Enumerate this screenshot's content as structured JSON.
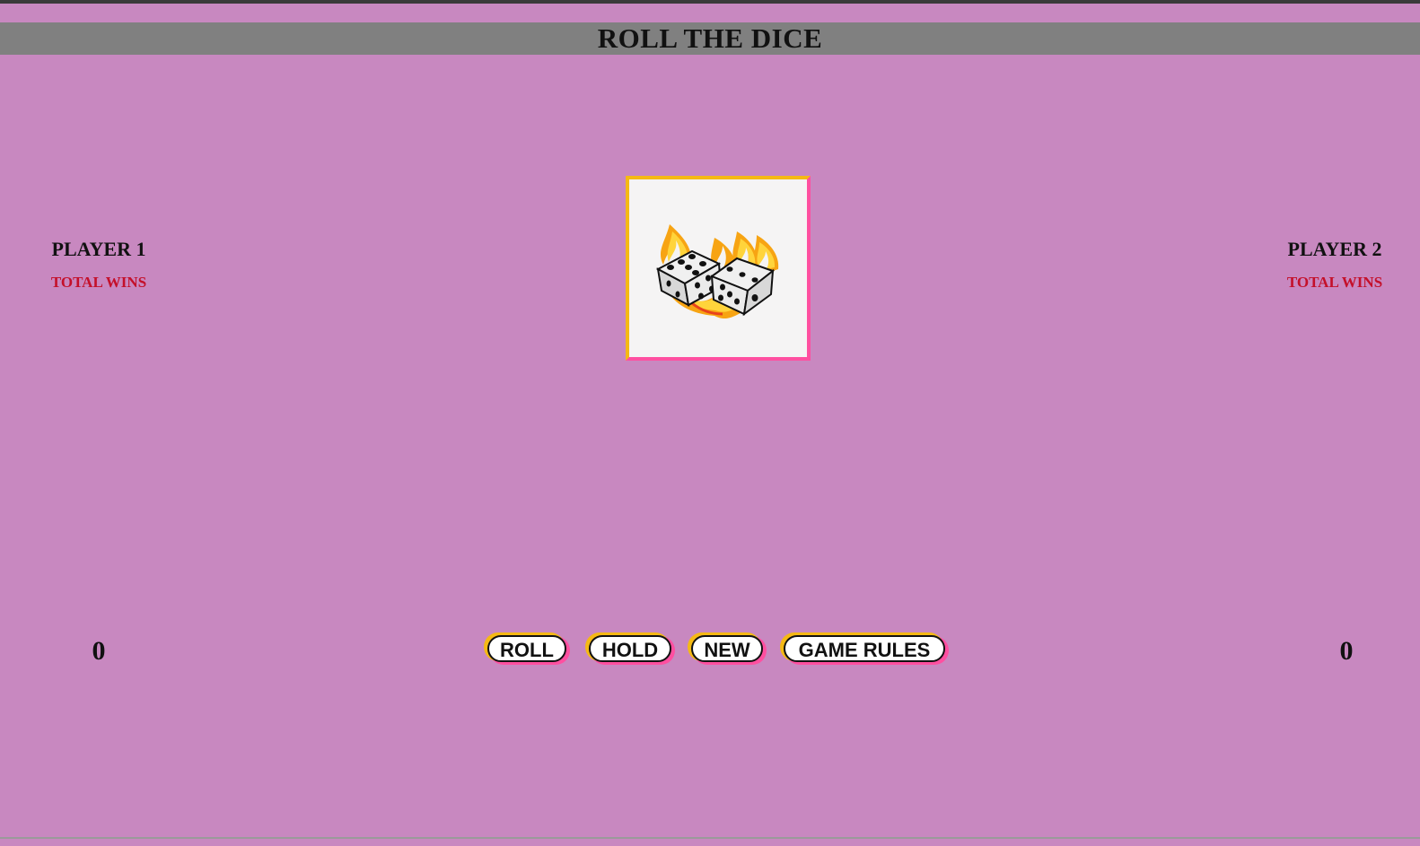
{
  "header": {
    "title": "ROLL THE DICE"
  },
  "players": [
    {
      "name": "PLAYER 1",
      "wins_label": "TOTAL WINS",
      "score": "0"
    },
    {
      "name": "PLAYER 2",
      "wins_label": "TOTAL WINS",
      "score": "0"
    }
  ],
  "dice_image": {
    "icon": "flaming-dice-icon"
  },
  "controls": {
    "roll_label": "ROLL",
    "hold_label": "HOLD",
    "new_label": "NEW",
    "rules_label": "GAME RULES"
  },
  "colors": {
    "background": "#c888c0",
    "title_bar": "#808080",
    "wins_label": "#c4102a",
    "accent_yellow": "#f5b914",
    "accent_pink": "#ff4fa0"
  }
}
